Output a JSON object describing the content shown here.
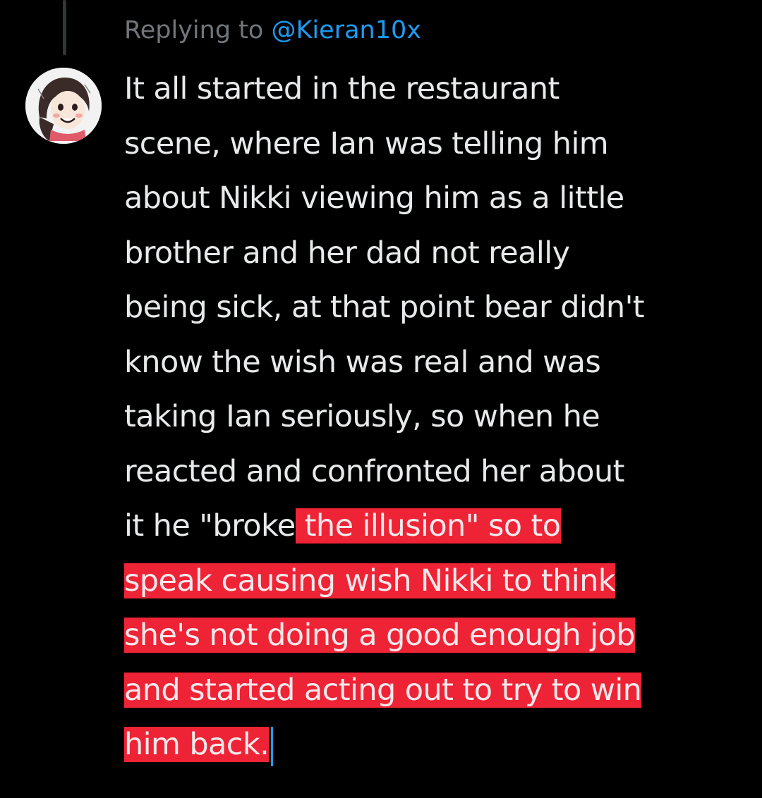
{
  "reply_context": {
    "prefix": "Replying to",
    "handle": "@Kieran10x"
  },
  "tweet": {
    "lines": [
      {
        "plain": "It all started in the restaurant",
        "highlighted": ""
      },
      {
        "plain": "scene, where Ian was telling him",
        "highlighted": ""
      },
      {
        "plain": "about Nikki viewing him as a little",
        "highlighted": ""
      },
      {
        "plain": "brother and her dad not really",
        "highlighted": ""
      },
      {
        "plain": "being sick, at that point bear didn't",
        "highlighted": ""
      },
      {
        "plain": "know the wish was real and was",
        "highlighted": ""
      },
      {
        "plain": "taking Ian seriously, so when he",
        "highlighted": ""
      },
      {
        "plain": "reacted and confronted her about",
        "highlighted": ""
      },
      {
        "plain": "it he \"broke",
        "highlighted": " the illusion\" so to"
      },
      {
        "plain": "",
        "highlighted": "speak causing wish Nikki to think"
      },
      {
        "plain": "",
        "highlighted": "she's not doing a good enough job"
      },
      {
        "plain": "",
        "highlighted": "and started acting out to try to win"
      },
      {
        "plain": "",
        "highlighted": "him back."
      }
    ]
  },
  "colors": {
    "background": "#000000",
    "text": "#e7e9ea",
    "muted": "#71767b",
    "link": "#1d9bf0",
    "highlight": "#ef2336",
    "thread_line": "#333639"
  },
  "icons": {
    "avatar": "user-avatar-cartoon"
  }
}
